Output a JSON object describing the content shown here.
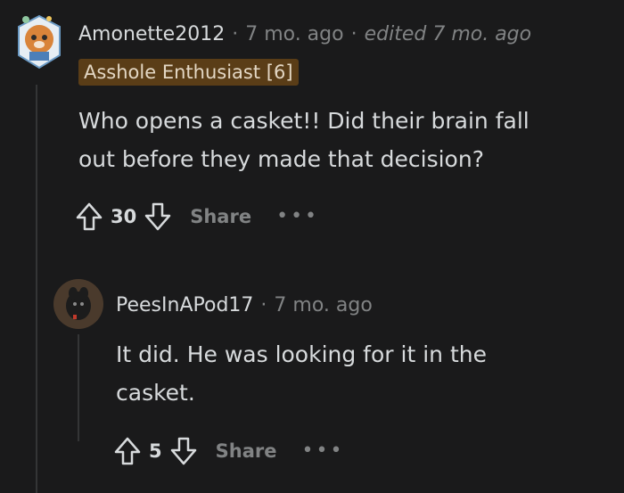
{
  "comment1": {
    "username": "Amonette2012",
    "separator1": "·",
    "time": "7 mo. ago",
    "separator2": "·",
    "edited": "edited 7 mo. ago",
    "flair": "Asshole Enthusiast [6]",
    "body_line1": "Who opens a casket!! Did their brain fall",
    "body_line2": "out before they made that decision?",
    "score": "30",
    "share_label": "Share",
    "more_label": "•••"
  },
  "comment2": {
    "username": "PeesInAPod17",
    "separator1": "·",
    "time": "7 mo. ago",
    "body_line1": "It did. He was looking for it in the",
    "body_line2": "casket.",
    "score": "5",
    "share_label": "Share",
    "more_label": "•••"
  }
}
